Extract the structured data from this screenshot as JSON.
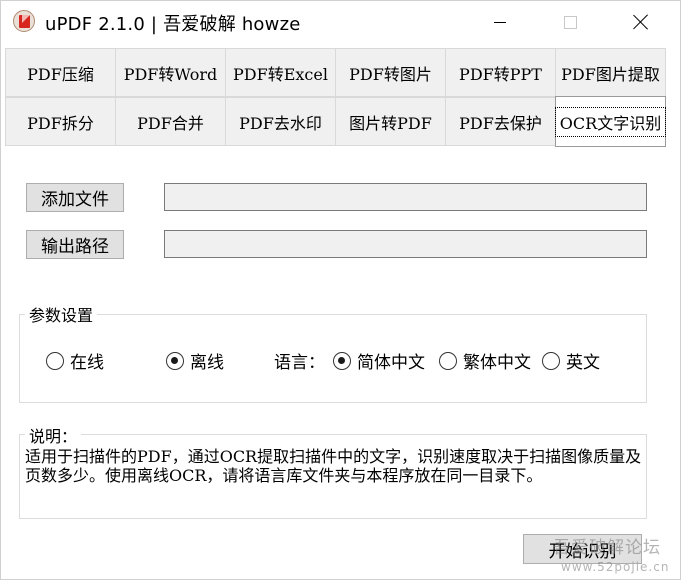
{
  "window": {
    "title": "uPDF 2.1.0 |  吾爱破解 howze",
    "icon": "pdf-app-icon"
  },
  "tabs": [
    {
      "label": "PDF压缩"
    },
    {
      "label": "PDF转Word"
    },
    {
      "label": "PDF转Excel"
    },
    {
      "label": "PDF转图片"
    },
    {
      "label": "PDF转PPT"
    },
    {
      "label": "PDF图片提取"
    },
    {
      "label": "PDF拆分"
    },
    {
      "label": "PDF合并"
    },
    {
      "label": "PDF去水印"
    },
    {
      "label": "图片转PDF"
    },
    {
      "label": "PDF去保护"
    },
    {
      "label": "OCR文字识别",
      "active": true
    }
  ],
  "files": {
    "add_label": "添加文件",
    "add_value": "",
    "output_label": "输出路径",
    "output_value": ""
  },
  "params": {
    "legend": "参数设置",
    "mode_options": [
      {
        "label": "在线",
        "checked": false
      },
      {
        "label": "离线",
        "checked": true
      }
    ],
    "language_label": "语言：",
    "language_options": [
      {
        "label": "简体中文",
        "checked": true
      },
      {
        "label": "繁体中文",
        "checked": false
      },
      {
        "label": "英文",
        "checked": false
      }
    ]
  },
  "description": {
    "legend": "说明：",
    "text": "适用于扫描件的PDF，通过OCR提取扫描件中的文字，识别速度取决于扫描图像质量及页数多少。使用离线OCR，请将语言库文件夹与本程序放在同一目录下。"
  },
  "actions": {
    "start_label": "开始识别"
  },
  "watermark": {
    "text": "吾爱破解论坛",
    "url": "www.52pojie.cn"
  }
}
